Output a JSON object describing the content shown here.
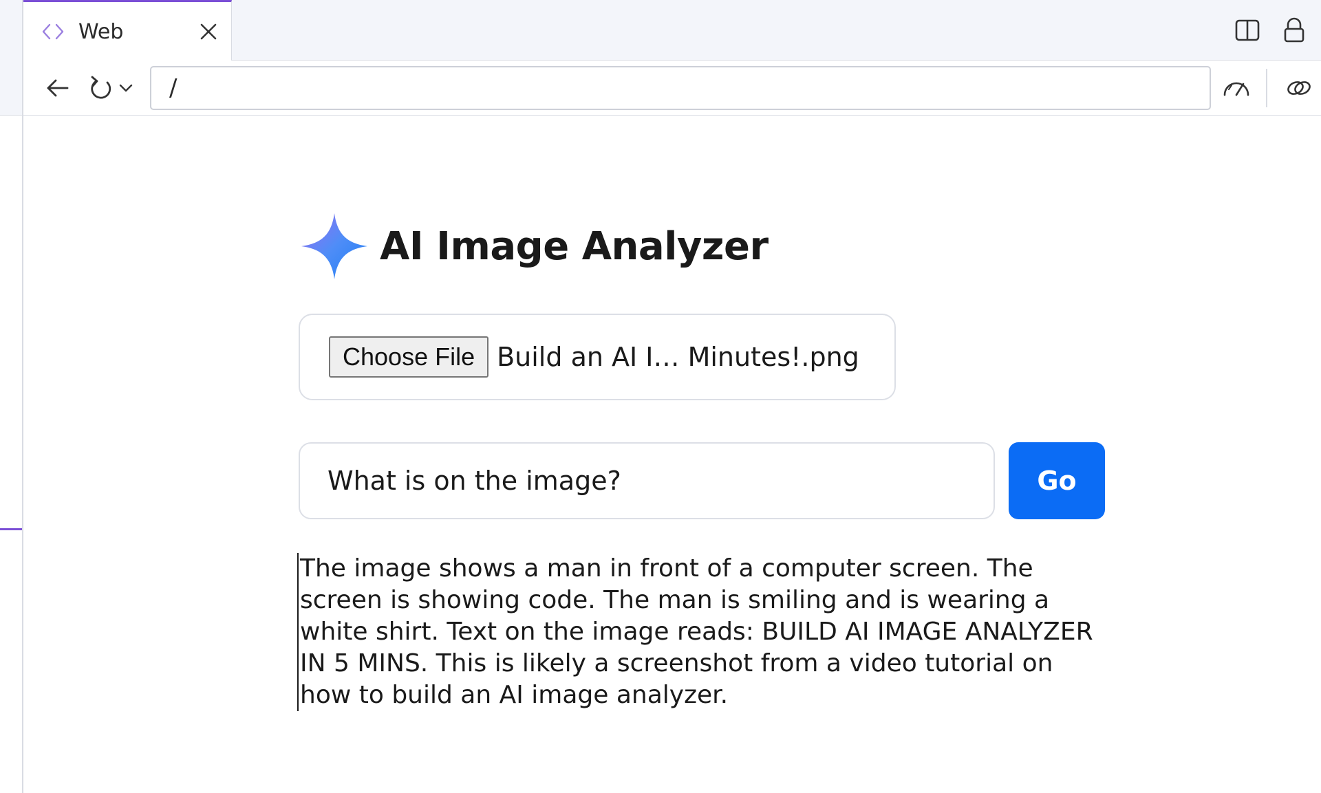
{
  "browser": {
    "tab": {
      "label": "Web"
    },
    "url": "/"
  },
  "page": {
    "title": "AI Image Analyzer",
    "file_input": {
      "button_label": "Choose File",
      "file_name": "Build an AI I… Minutes!.png"
    },
    "question": {
      "value": "What is on the image?"
    },
    "go_label": "Go",
    "result": "The image shows a man in front of a computer screen. The screen is showing code. The man is smiling and is wearing a white shirt. Text on the image reads: BUILD AI IMAGE ANALYZER IN 5 MINS. This is likely a screenshot from a video tutorial on how to build an AI image analyzer."
  },
  "colors": {
    "accent_purple": "#7b4fd6",
    "go_button": "#0b6cf5"
  },
  "icons": [
    "code-icon",
    "close-icon",
    "split-view-icon",
    "lock-icon",
    "back-arrow-icon",
    "reload-icon",
    "chevron-down-icon",
    "speedometer-icon",
    "link-icon",
    "sparkle-icon"
  ]
}
